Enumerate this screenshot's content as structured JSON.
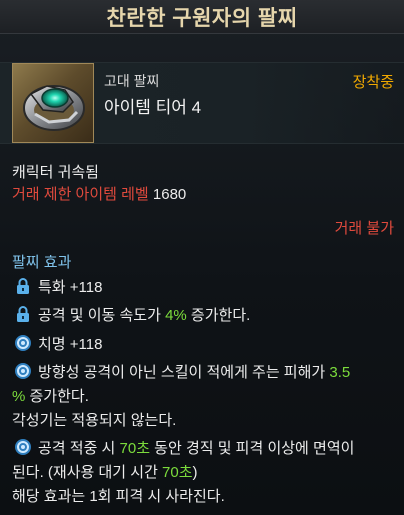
{
  "tooltip": {
    "title": "찬란한 구원자의 팔찌",
    "item": {
      "grade": "고대 팔찌",
      "tier": "아이템 티어 4",
      "status": "장착중"
    },
    "binding": "캐릭터 귀속됨",
    "trade_restriction_label": "거래 제한 아이템 레벨",
    "trade_restriction_value": "1680",
    "trade_status": "거래 불가",
    "effects_title": "팔찌 효과",
    "effects": [
      {
        "icon": "lock-icon",
        "text": "특화 +118"
      },
      {
        "icon": "lock-icon",
        "text_before": "공격 및 이동 속도가 ",
        "highlight": "4%",
        "text_after": " 증가한다."
      },
      {
        "icon": "swirl-icon",
        "text": "치명 +118"
      },
      {
        "icon": "swirl-icon",
        "line1_before": "방향성 공격이 아닌 스킬이 적에게 주는 피해가 ",
        "line1_highlight": "3.5",
        "line2_highlight": "%",
        "line2_after": " 증가한다."
      },
      {
        "line": "각성기는 적용되지 않는다."
      },
      {
        "icon": "swirl-icon",
        "line1_before": "공격 적중 시 ",
        "line1_highlight": "70초",
        "line1_after": " 동안 경직 및 피격 이상에 면역이",
        "line2_before": "된다. (재사용 대기 시간 ",
        "line2_highlight": "70초",
        "line2_after": ")"
      },
      {
        "line": "해당 효과는 1회 피격 시 사라진다."
      }
    ]
  },
  "colors": {
    "title": "#e6d6ac",
    "equipped": "#f0a800",
    "red": "#e04a3d",
    "green": "#7cdc3c",
    "section": "#7fc2ea"
  }
}
